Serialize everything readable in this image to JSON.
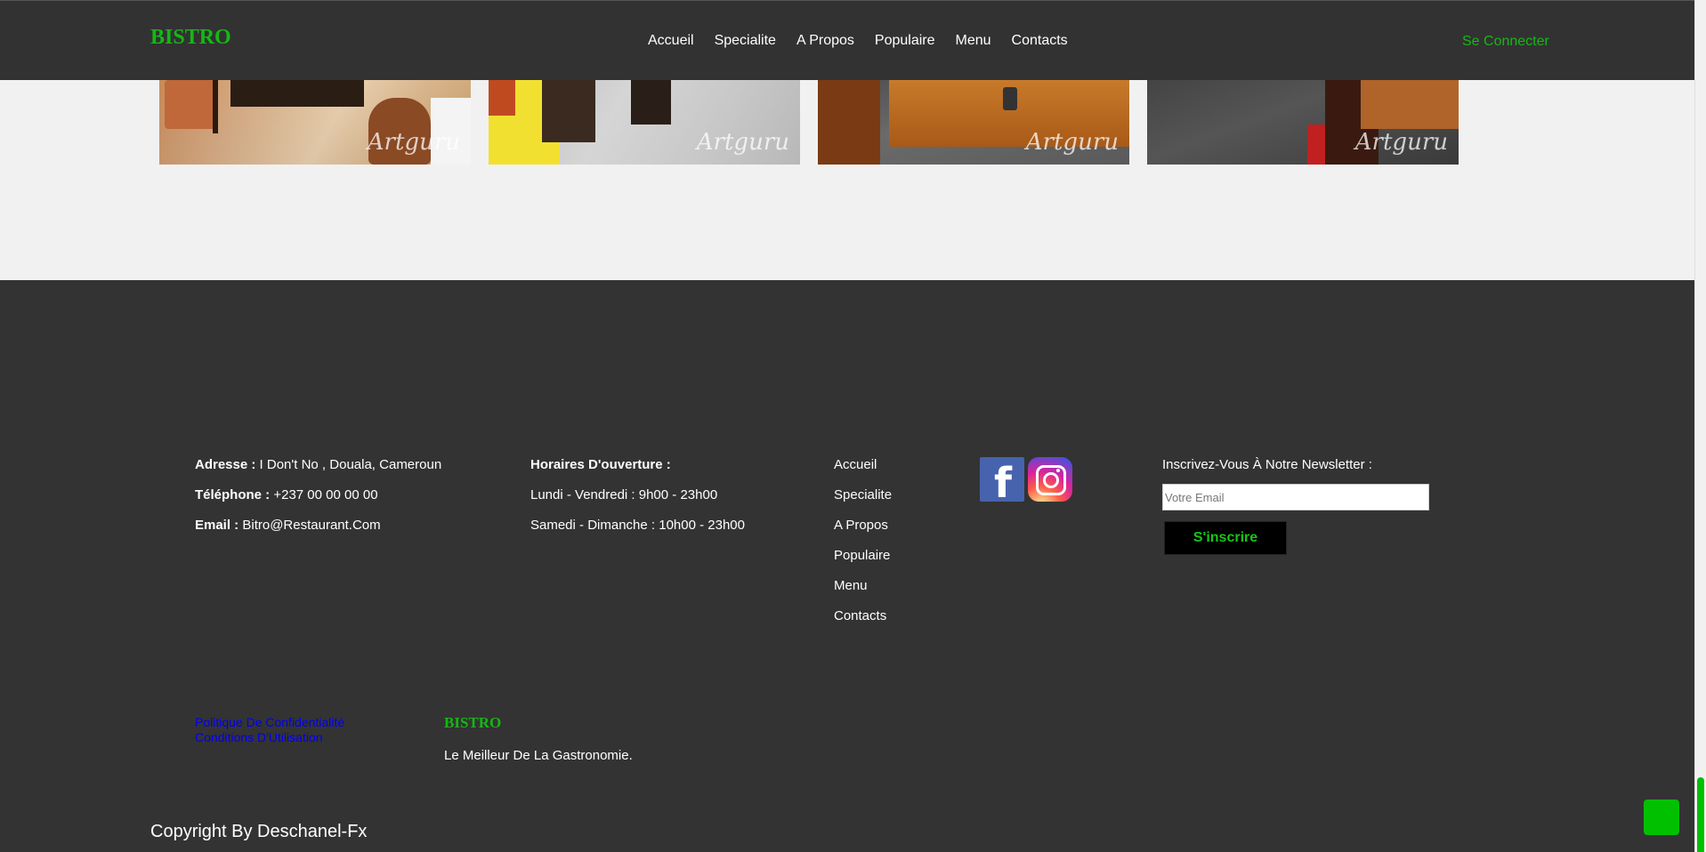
{
  "header": {
    "brand": "BISTRO",
    "nav": [
      "Accueil",
      "Specialite",
      "A Propos",
      "Populaire",
      "Menu",
      "Contacts"
    ],
    "login": "Se Connecter"
  },
  "gallery": {
    "watermark": "Artguru"
  },
  "footer": {
    "contact": {
      "address_label": "Adresse :",
      "address_value": " I Don't No , Douala, Cameroun",
      "phone_label": "Téléphone :",
      "phone_value": " +237 00 00 00 00",
      "email_label": "Email :",
      "email_value": " Bitro@Restaurant.Com"
    },
    "hours": {
      "title": "Horaires D'ouverture :",
      "weekdays": "Lundi - Vendredi : 9h00 - 23h00",
      "weekend": "Samedi - Dimanche : 10h00 - 23h00"
    },
    "links": [
      "Accueil",
      "Specialite",
      "A Propos",
      "Populaire",
      "Menu",
      "Contacts"
    ],
    "social": {
      "facebook": "facebook-icon",
      "instagram": "instagram-icon"
    },
    "newsletter": {
      "title": "Inscrivez-Vous À Notre Newsletter :",
      "placeholder": "Votre Email",
      "button": "S'inscrire"
    },
    "legal": {
      "privacy": "Politique De Confidentialité",
      "terms": "Conditions D'Utilisation"
    },
    "brand": "BISTRO",
    "tagline": "Le Meilleur De La Gastronomie.",
    "copyright": "Copyright By Deschanel-Fx"
  },
  "colors": {
    "accent": "#14b814",
    "background_dark": "#333333",
    "background_light": "#f1f1f1",
    "link_blue": "#0000ee"
  }
}
